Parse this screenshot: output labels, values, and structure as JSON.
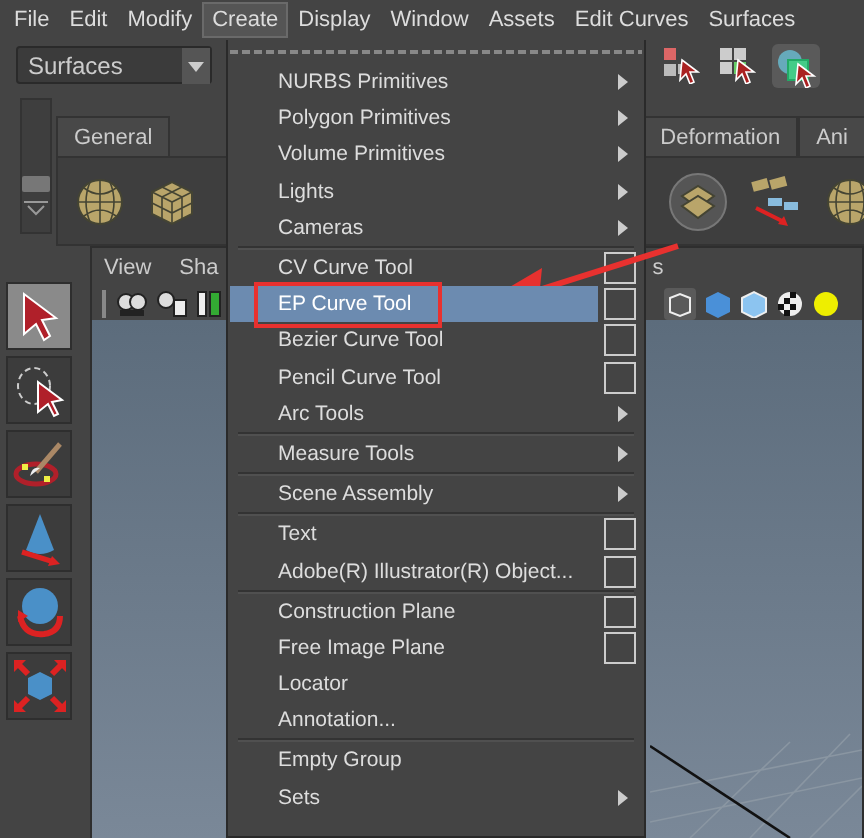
{
  "menu_bar": [
    {
      "label": "File",
      "selected": false
    },
    {
      "label": "Edit",
      "selected": false
    },
    {
      "label": "Modify",
      "selected": false
    },
    {
      "label": "Create",
      "selected": true
    },
    {
      "label": "Display",
      "selected": false
    },
    {
      "label": "Window",
      "selected": false
    },
    {
      "label": "Assets",
      "selected": false
    },
    {
      "label": "Edit Curves",
      "selected": false
    },
    {
      "label": "Surfaces",
      "selected": false
    }
  ],
  "toolbar": {
    "menu_set": "Surfaces"
  },
  "shelf": {
    "tabs": [
      {
        "label": "General",
        "selected": false
      },
      {
        "label": "Deformation",
        "selected": false
      },
      {
        "label": "Ani",
        "selected": false
      }
    ]
  },
  "toolbox": [
    {
      "selected": true
    },
    {
      "selected": false
    },
    {
      "selected": false
    },
    {
      "selected": false
    },
    {
      "selected": false
    },
    {
      "selected": false
    }
  ],
  "panel_menu": [
    "View",
    "Sha",
    "s"
  ],
  "create_menu": [
    {
      "kind": "tearoff"
    },
    {
      "kind": "submenu",
      "label": "NURBS Primitives",
      "selected": false
    },
    {
      "kind": "submenu",
      "label": "Polygon Primitives",
      "selected": false
    },
    {
      "kind": "submenu",
      "label": "Volume Primitives",
      "selected": false
    },
    {
      "kind": "submenu",
      "label": "Lights",
      "selected": false
    },
    {
      "kind": "submenu",
      "label": "Cameras",
      "selected": false
    },
    {
      "kind": "separator"
    },
    {
      "kind": "option",
      "label": "CV Curve Tool",
      "selected": false
    },
    {
      "kind": "option",
      "label": "EP Curve Tool",
      "selected": true,
      "callout": true
    },
    {
      "kind": "option",
      "label": "Bezier Curve Tool",
      "selected": false
    },
    {
      "kind": "option",
      "label": "Pencil Curve Tool",
      "selected": false
    },
    {
      "kind": "submenu",
      "label": "Arc Tools",
      "selected": false
    },
    {
      "kind": "separator"
    },
    {
      "kind": "submenu",
      "label": "Measure Tools",
      "selected": false
    },
    {
      "kind": "separator"
    },
    {
      "kind": "submenu",
      "label": "Scene Assembly",
      "selected": false
    },
    {
      "kind": "separator"
    },
    {
      "kind": "option",
      "label": "Text",
      "selected": false
    },
    {
      "kind": "option",
      "label": "Adobe(R) Illustrator(R) Object...",
      "selected": false
    },
    {
      "kind": "separator"
    },
    {
      "kind": "option",
      "label": "Construction Plane",
      "selected": false
    },
    {
      "kind": "option",
      "label": "Free Image Plane",
      "selected": false
    },
    {
      "kind": "plain",
      "label": "Locator",
      "selected": false
    },
    {
      "kind": "plain",
      "label": "Annotation...",
      "selected": false
    },
    {
      "kind": "separator"
    },
    {
      "kind": "plain",
      "label": "Empty Group",
      "selected": false
    },
    {
      "kind": "submenu",
      "label": "Sets",
      "selected": false
    }
  ]
}
